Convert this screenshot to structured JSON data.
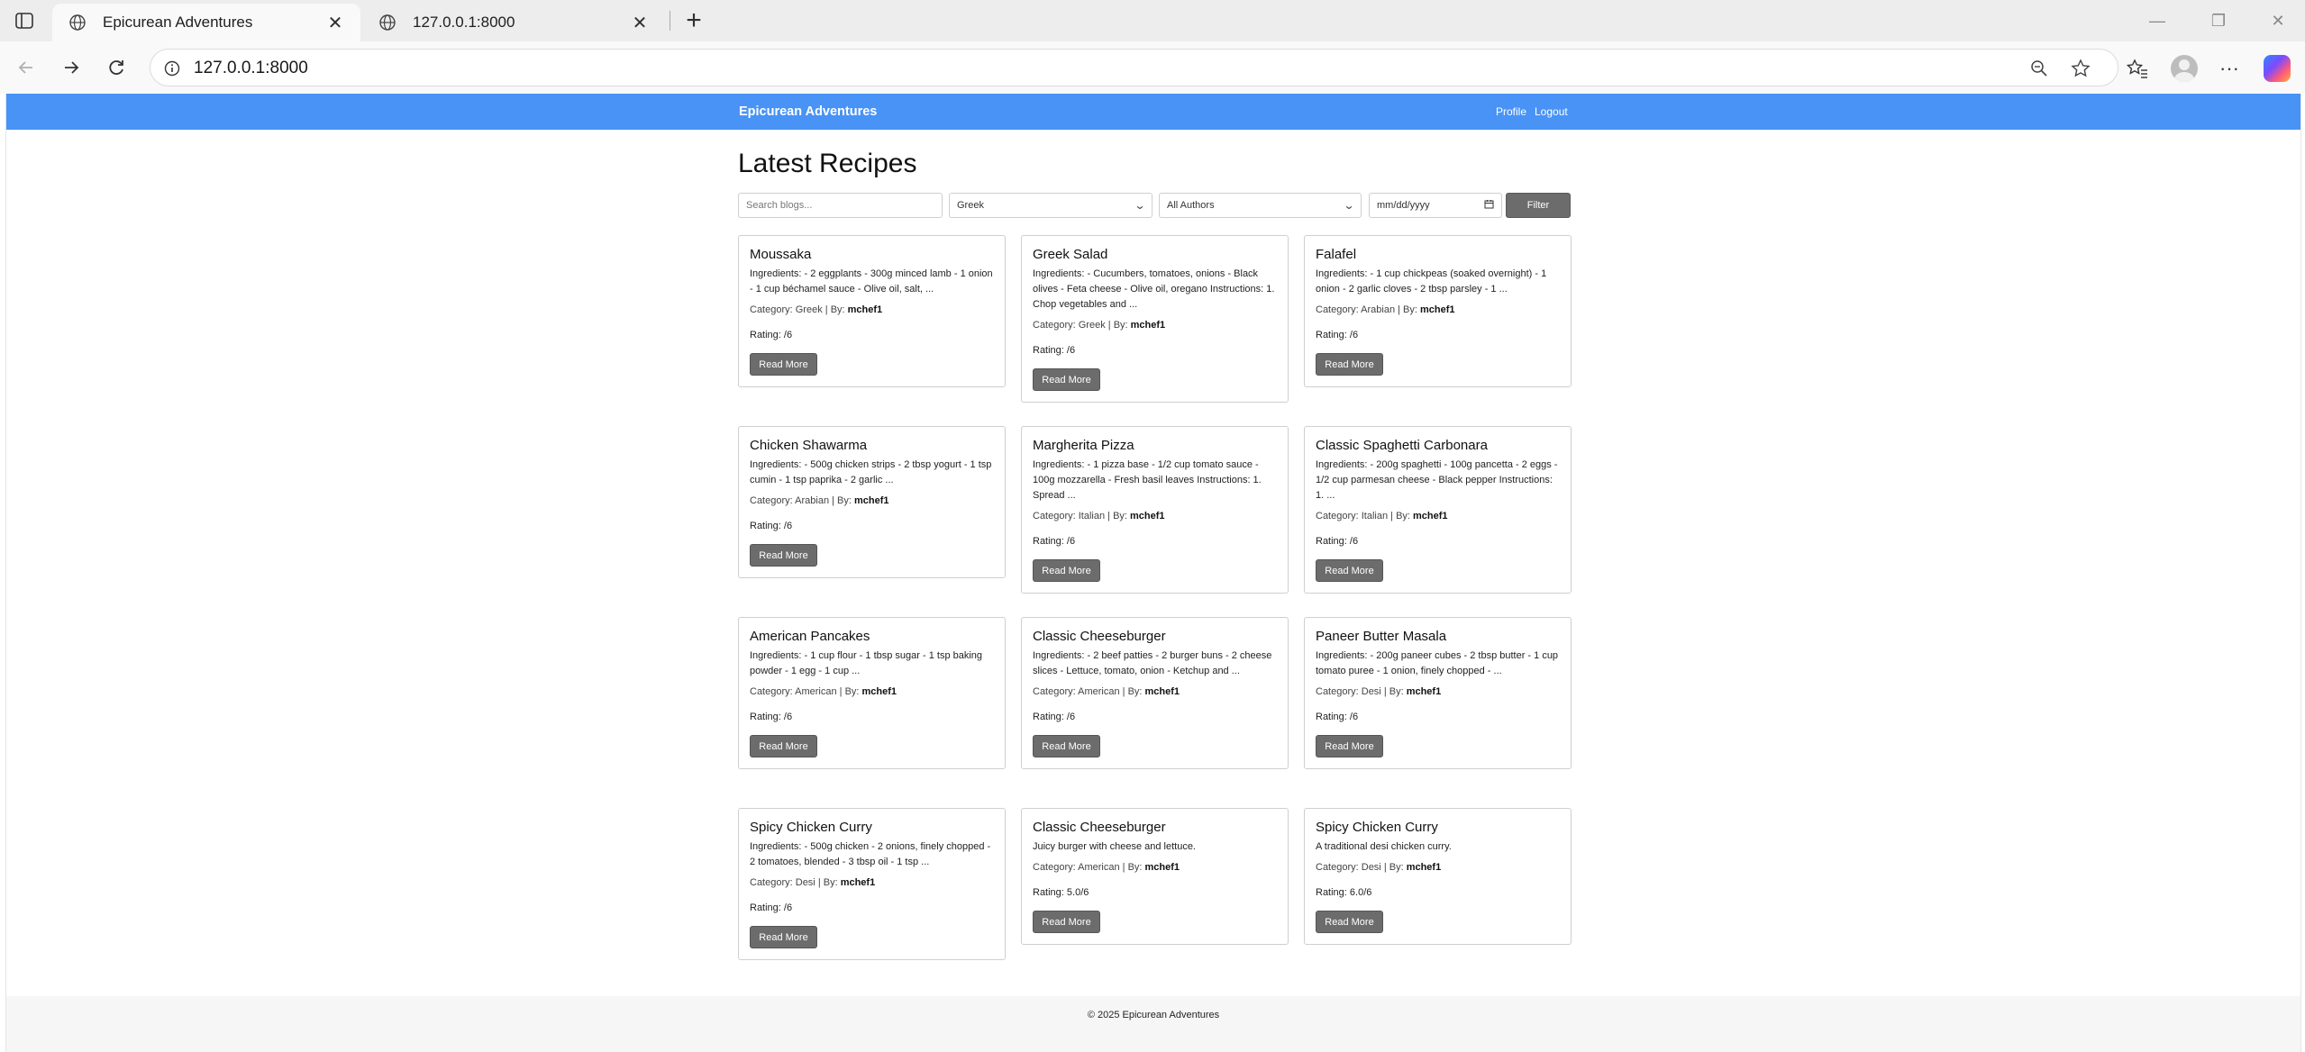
{
  "browser": {
    "tabs": [
      {
        "title": "Epicurean Adventures",
        "active": true
      },
      {
        "title": "127.0.0.1:8000",
        "active": false
      }
    ],
    "address": "127.0.0.1:8000"
  },
  "site": {
    "brand": "Epicurean Adventures",
    "nav": {
      "profile": "Profile",
      "logout": "Logout"
    },
    "accent_color": "#4893f5"
  },
  "page": {
    "title": "Latest Recipes",
    "filters": {
      "search_placeholder": "Search blogs...",
      "category_selected": "Greek",
      "author_selected": "All Authors",
      "date_placeholder": "mm/dd/yyyy",
      "filter_label": "Filter"
    }
  },
  "recipes": [
    {
      "title": "Moussaka",
      "desc": "Ingredients: - 2 eggplants - 300g minced lamb - 1 onion - 1 cup béchamel sauce - Olive oil, salt, ...",
      "category": "Greek",
      "author": "mchef1",
      "rating": "Rating: /6"
    },
    {
      "title": "Greek Salad",
      "desc": "Ingredients: - Cucumbers, tomatoes, onions - Black olives - Feta cheese - Olive oil, oregano Instructions: 1. Chop vegetables and ...",
      "category": "Greek",
      "author": "mchef1",
      "rating": "Rating: /6"
    },
    {
      "title": "Falafel",
      "desc": "Ingredients: - 1 cup chickpeas (soaked overnight) - 1 onion - 2 garlic cloves - 2 tbsp parsley - 1 ...",
      "category": "Arabian",
      "author": "mchef1",
      "rating": "Rating: /6"
    },
    {
      "title": "Chicken Shawarma",
      "desc": "Ingredients: - 500g chicken strips - 2 tbsp yogurt - 1 tsp cumin - 1 tsp paprika - 2 garlic ...",
      "category": "Arabian",
      "author": "mchef1",
      "rating": "Rating: /6"
    },
    {
      "title": "Margherita Pizza",
      "desc": "Ingredients: - 1 pizza base - 1/2 cup tomato sauce - 100g mozzarella - Fresh basil leaves Instructions: 1. Spread ...",
      "category": "Italian",
      "author": "mchef1",
      "rating": "Rating: /6"
    },
    {
      "title": "Classic Spaghetti Carbonara",
      "desc": "Ingredients: - 200g spaghetti - 100g pancetta - 2 eggs - 1/2 cup parmesan cheese - Black pepper Instructions: 1. ...",
      "category": "Italian",
      "author": "mchef1",
      "rating": "Rating: /6"
    },
    {
      "title": "American Pancakes",
      "desc": "Ingredients: - 1 cup flour - 1 tbsp sugar - 1 tsp baking powder - 1 egg - 1 cup ...",
      "category": "American",
      "author": "mchef1",
      "rating": "Rating: /6"
    },
    {
      "title": "Classic Cheeseburger",
      "desc": "Ingredients: - 2 beef patties - 2 burger buns - 2 cheese slices - Lettuce, tomato, onion - Ketchup and ...",
      "category": "American",
      "author": "mchef1",
      "rating": "Rating: /6"
    },
    {
      "title": "Paneer Butter Masala",
      "desc": "Ingredients: - 200g paneer cubes - 2 tbsp butter - 1 cup tomato puree - 1 onion, finely chopped - ...",
      "category": "Desi",
      "author": "mchef1",
      "rating": "Rating: /6"
    },
    {
      "title": "Spicy Chicken Curry",
      "desc": "Ingredients: - 500g chicken - 2 onions, finely chopped - 2 tomatoes, blended - 3 tbsp oil - 1 tsp ...",
      "category": "Desi",
      "author": "mchef1",
      "rating": "Rating: /6"
    },
    {
      "title": "Classic Cheeseburger",
      "desc": "Juicy burger with cheese and lettuce.",
      "category": "American",
      "author": "mchef1",
      "rating": "Rating: 5.0/6"
    },
    {
      "title": "Spicy Chicken Curry",
      "desc": "A traditional desi chicken curry.",
      "category": "Desi",
      "author": "mchef1",
      "rating": "Rating: 6.0/6"
    }
  ],
  "labels": {
    "category_prefix": "Category: ",
    "by_prefix": " | By: ",
    "read_more": "Read More"
  },
  "footer": {
    "text": "© 2025 Epicurean Adventures"
  }
}
